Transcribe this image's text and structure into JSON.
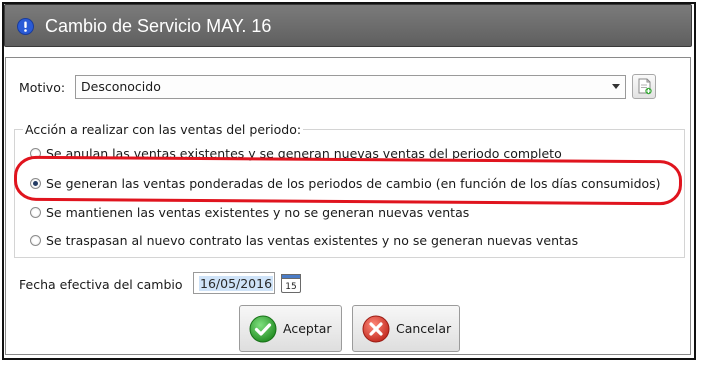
{
  "window": {
    "title": "Cambio de Servicio MAY. 16",
    "title_icon": "info-exclamation-icon"
  },
  "motivo": {
    "label": "Motivo:",
    "value": "Desconocido",
    "new_button_icon": "new-document-icon"
  },
  "group": {
    "title": "Acción a realizar con las ventas del periodo:",
    "options": [
      {
        "label": "Se anulan las ventas existentes y se generan nuevas ventas del periodo completo",
        "checked": false
      },
      {
        "label": "Se generan las ventas ponderadas de los periodos de cambio (en función de los días consumidos)",
        "checked": true
      },
      {
        "label": "Se mantienen las ventas existentes y no se generan nuevas ventas",
        "checked": false
      },
      {
        "label": "Se traspasan al nuevo contrato las ventas existentes y no se generan nuevas ventas",
        "checked": false
      }
    ]
  },
  "fecha": {
    "label": "Fecha efectiva del cambio",
    "value": "16/05/2016",
    "calendar_day": "15"
  },
  "buttons": {
    "accept": "Aceptar",
    "cancel": "Cancelar"
  },
  "colors": {
    "highlight": "#e0141e",
    "titlebar": "#6c6c6c",
    "accept_green": "#2aa02a",
    "cancel_red": "#d8342a"
  }
}
